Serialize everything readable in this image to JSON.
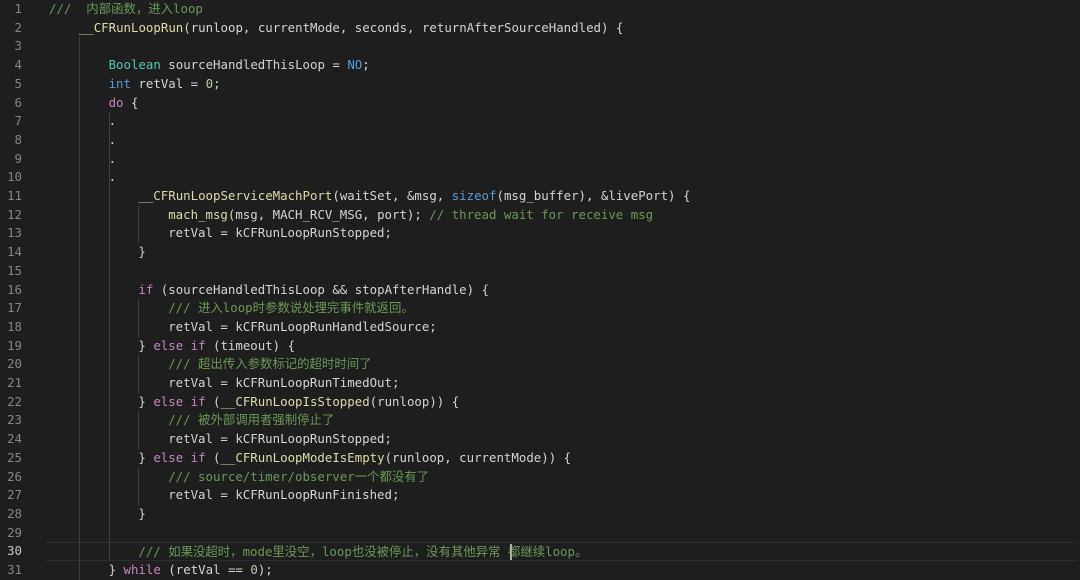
{
  "editor": {
    "active_line": 30,
    "lines": [
      {
        "number": "1",
        "indent": 0,
        "tokens": [
          {
            "t": "///  内部函数，进入loop",
            "c": "comment"
          }
        ]
      },
      {
        "number": "2",
        "indent": 1,
        "tokens": [
          {
            "t": "__CFRunLoopRun",
            "c": "func"
          },
          {
            "t": "(runloop, currentMode, seconds, returnAfterSourceHandled) {",
            "c": "text"
          }
        ]
      },
      {
        "number": "3",
        "indent": 0,
        "tokens": []
      },
      {
        "number": "4",
        "indent": 2,
        "tokens": [
          {
            "t": "Boolean",
            "c": "type"
          },
          {
            "t": " sourceHandledThisLoop = ",
            "c": "text"
          },
          {
            "t": "NO",
            "c": "const"
          },
          {
            "t": ";",
            "c": "text"
          }
        ]
      },
      {
        "number": "5",
        "indent": 2,
        "tokens": [
          {
            "t": "int",
            "c": "storage"
          },
          {
            "t": " retVal = ",
            "c": "text"
          },
          {
            "t": "0",
            "c": "number"
          },
          {
            "t": ";",
            "c": "text"
          }
        ]
      },
      {
        "number": "6",
        "indent": 2,
        "tokens": [
          {
            "t": "do",
            "c": "keyword"
          },
          {
            "t": " {",
            "c": "text"
          }
        ]
      },
      {
        "number": "7",
        "indent": 2,
        "tokens": [
          {
            "t": ".",
            "c": "text"
          }
        ]
      },
      {
        "number": "8",
        "indent": 2,
        "tokens": [
          {
            "t": ".",
            "c": "text"
          }
        ]
      },
      {
        "number": "9",
        "indent": 2,
        "tokens": [
          {
            "t": ".",
            "c": "text"
          }
        ]
      },
      {
        "number": "10",
        "indent": 2,
        "tokens": [
          {
            "t": ".",
            "c": "text"
          }
        ]
      },
      {
        "number": "11",
        "indent": 3,
        "tokens": [
          {
            "t": "__CFRunLoopServiceMachPort",
            "c": "func"
          },
          {
            "t": "(waitSet, &msg, ",
            "c": "text"
          },
          {
            "t": "sizeof",
            "c": "storage"
          },
          {
            "t": "(msg_buffer), &livePort) {",
            "c": "text"
          }
        ]
      },
      {
        "number": "12",
        "indent": 4,
        "tokens": [
          {
            "t": "mach_msg",
            "c": "func"
          },
          {
            "t": "(msg, MACH_RCV_MSG, port); ",
            "c": "text"
          },
          {
            "t": "// thread wait for receive msg",
            "c": "comment"
          }
        ]
      },
      {
        "number": "13",
        "indent": 4,
        "tokens": [
          {
            "t": "retVal = kCFRunLoopRunStopped;",
            "c": "text"
          }
        ]
      },
      {
        "number": "14",
        "indent": 3,
        "tokens": [
          {
            "t": "}",
            "c": "text"
          }
        ]
      },
      {
        "number": "15",
        "indent": 0,
        "tokens": []
      },
      {
        "number": "16",
        "indent": 3,
        "tokens": [
          {
            "t": "if",
            "c": "keyword"
          },
          {
            "t": " (sourceHandledThisLoop && stopAfterHandle) {",
            "c": "text"
          }
        ]
      },
      {
        "number": "17",
        "indent": 4,
        "tokens": [
          {
            "t": "/// 进入loop时参数说处理完事件就返回。",
            "c": "comment"
          }
        ]
      },
      {
        "number": "18",
        "indent": 4,
        "tokens": [
          {
            "t": "retVal = kCFRunLoopRunHandledSource;",
            "c": "text"
          }
        ]
      },
      {
        "number": "19",
        "indent": 3,
        "tokens": [
          {
            "t": "} ",
            "c": "text"
          },
          {
            "t": "else if",
            "c": "keyword"
          },
          {
            "t": " (timeout) {",
            "c": "text"
          }
        ]
      },
      {
        "number": "20",
        "indent": 4,
        "tokens": [
          {
            "t": "/// 超出传入参数标记的超时时间了",
            "c": "comment"
          }
        ]
      },
      {
        "number": "21",
        "indent": 4,
        "tokens": [
          {
            "t": "retVal = kCFRunLoopRunTimedOut;",
            "c": "text"
          }
        ]
      },
      {
        "number": "22",
        "indent": 3,
        "tokens": [
          {
            "t": "} ",
            "c": "text"
          },
          {
            "t": "else if",
            "c": "keyword"
          },
          {
            "t": " (",
            "c": "text"
          },
          {
            "t": "__CFRunLoopIsStopped",
            "c": "func"
          },
          {
            "t": "(runloop)) {",
            "c": "text"
          }
        ]
      },
      {
        "number": "23",
        "indent": 4,
        "tokens": [
          {
            "t": "/// 被外部调用者强制停止了",
            "c": "comment"
          }
        ]
      },
      {
        "number": "24",
        "indent": 4,
        "tokens": [
          {
            "t": "retVal = kCFRunLoopRunStopped;",
            "c": "text"
          }
        ]
      },
      {
        "number": "25",
        "indent": 3,
        "tokens": [
          {
            "t": "} ",
            "c": "text"
          },
          {
            "t": "else if",
            "c": "keyword"
          },
          {
            "t": " (",
            "c": "text"
          },
          {
            "t": "__CFRunLoopModeIsEmpty",
            "c": "func"
          },
          {
            "t": "(runloop, currentMode)) {",
            "c": "text"
          }
        ]
      },
      {
        "number": "26",
        "indent": 4,
        "tokens": [
          {
            "t": "/// source/timer/observer一个都没有了",
            "c": "comment"
          }
        ]
      },
      {
        "number": "27",
        "indent": 4,
        "tokens": [
          {
            "t": "retVal = kCFRunLoopRunFinished;",
            "c": "text"
          }
        ]
      },
      {
        "number": "28",
        "indent": 3,
        "tokens": [
          {
            "t": "}",
            "c": "text"
          }
        ]
      },
      {
        "number": "29",
        "indent": 0,
        "tokens": []
      },
      {
        "number": "30",
        "indent": 3,
        "tokens": [
          {
            "t": "/// 如果没超时，mode里没空，loop也没被停止，没有其他异常 ",
            "c": "comment"
          },
          {
            "t": "都继续loop。",
            "c": "comment"
          }
        ]
      },
      {
        "number": "31",
        "indent": 2,
        "tokens": [
          {
            "t": "} ",
            "c": "text"
          },
          {
            "t": "while",
            "c": "keyword"
          },
          {
            "t": " (retVal == ",
            "c": "text"
          },
          {
            "t": "0",
            "c": "number"
          },
          {
            "t": ");",
            "c": "text"
          }
        ]
      }
    ]
  },
  "colors": {
    "background": "#1e1e1e",
    "comment": "#6a9955",
    "keyword": "#c586c0",
    "type": "#4ec9b0",
    "function": "#dcdcaa",
    "number": "#b5cea8",
    "text": "#d4d4d4"
  }
}
